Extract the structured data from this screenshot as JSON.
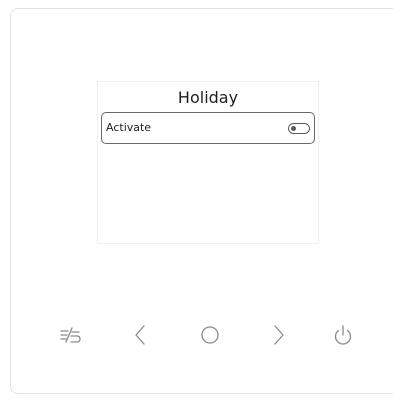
{
  "screen": {
    "title": "Holiday",
    "menu": [
      {
        "label": "Activate",
        "toggle_state": "off"
      }
    ]
  },
  "controls": [
    {
      "name": "mode-button",
      "icon": "mode-icon"
    },
    {
      "name": "left-button",
      "icon": "chevron-left-icon"
    },
    {
      "name": "ok-button",
      "icon": "circle-icon"
    },
    {
      "name": "right-button",
      "icon": "chevron-right-icon"
    },
    {
      "name": "power-button",
      "icon": "power-icon"
    }
  ],
  "colors": {
    "icon": "#8a8a8a",
    "text": "#1e1e1e",
    "row_border": "#6a6a6a"
  }
}
